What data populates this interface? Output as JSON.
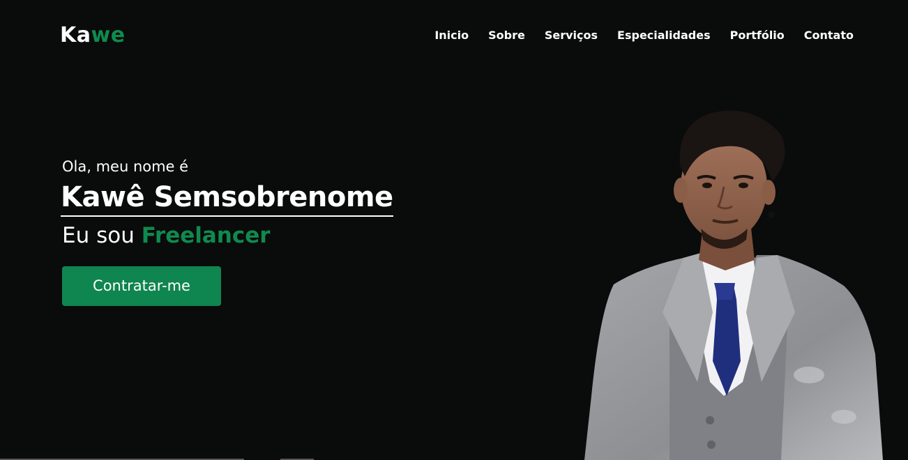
{
  "header": {
    "logo": {
      "part1": "Ka",
      "part2": "we"
    },
    "nav": [
      {
        "label": "Inicio"
      },
      {
        "label": "Sobre"
      },
      {
        "label": "Serviços"
      },
      {
        "label": "Especialidades"
      },
      {
        "label": "Portfólio"
      },
      {
        "label": "Contato"
      }
    ]
  },
  "hero": {
    "greeting": "Ola, meu nome é",
    "name": "Kawê Semsobrenome",
    "role_prefix": "Eu sou",
    "role_accent": "Freelancer",
    "cta_label": "Contratar-me"
  },
  "colors": {
    "background": "#0a0b0b",
    "accent": "#0f8a4e",
    "button": "#0f854f",
    "text": "#ffffff"
  },
  "icons": {
    "portrait": "person-photo"
  }
}
